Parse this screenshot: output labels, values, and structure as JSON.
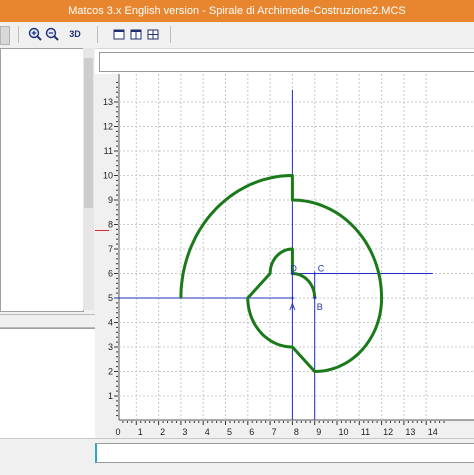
{
  "window": {
    "title": "Matcos 3.x English version - Spirale di Archimede-Costruzione2.MCS"
  },
  "toolbar": {
    "btn_3d": "3D"
  },
  "icons": [
    "zoom-in-icon",
    "zoom-out-icon",
    "window-icon",
    "layout-icon",
    "grid-icon"
  ],
  "colors": {
    "title_bg": "#e8862f",
    "spiral": "#1a7a1a",
    "axis": "#2030c0",
    "grid": "#c8c8c8"
  },
  "chart_data": {
    "type": "line",
    "x_ticks": [
      "0",
      "1",
      "2",
      "3",
      "4",
      "5",
      "6",
      "7",
      "8",
      "9",
      "10",
      "11",
      "12",
      "13",
      "14"
    ],
    "y_ticks": [
      "1",
      "2",
      "3",
      "4",
      "5",
      "6",
      "7",
      "8",
      "9",
      "10",
      "11",
      "12",
      "13"
    ],
    "xlim": [
      0,
      14.3
    ],
    "ylim": [
      -0.3,
      13.5
    ],
    "grid": true,
    "points": [
      {
        "label": "A",
        "x": 8,
        "y": 5
      },
      {
        "label": "B",
        "x": 9,
        "y": 5
      },
      {
        "label": "C",
        "x": 9,
        "y": 6
      },
      {
        "label": "D",
        "x": 8,
        "y": 6
      }
    ],
    "spiral_arcs": [
      {
        "center": [
          8,
          5
        ],
        "radius": 1,
        "from_deg": 0,
        "to_deg": 90
      },
      {
        "center": [
          8,
          6
        ],
        "radius": 1,
        "from_deg": 90,
        "to_deg": 180
      },
      {
        "center": [
          8,
          5
        ],
        "radius": 2,
        "from_deg": 180,
        "to_deg": 270
      },
      {
        "center": [
          9,
          5
        ],
        "radius": 3,
        "from_deg": 270,
        "to_deg": 360
      },
      {
        "center": [
          8,
          5
        ],
        "radius": 4,
        "from_deg": 0,
        "to_deg": 90
      },
      {
        "center": [
          8,
          5
        ],
        "radius": 5,
        "from_deg": 90,
        "to_deg": 180
      }
    ],
    "axis_lines": [
      {
        "type": "horizontal",
        "y": 5,
        "x_from": 0,
        "x_to": 8
      },
      {
        "type": "vertical",
        "x": 8,
        "y_from": 0,
        "y_to": 13.5
      },
      {
        "type": "horizontal",
        "y": 6,
        "x_from": 8,
        "x_to": 14.3
      },
      {
        "type": "vertical",
        "x": 9,
        "y_from": 0,
        "y_to": 6
      }
    ]
  }
}
